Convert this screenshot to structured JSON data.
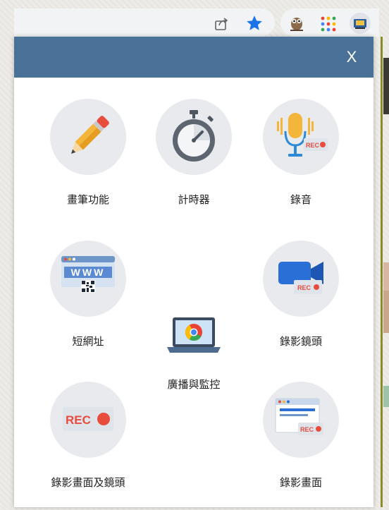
{
  "browser": {
    "toolbar_icons": [
      "share-icon",
      "star-icon",
      "owl-extension-icon",
      "apps-grid-icon",
      "extension-icon"
    ],
    "accent": "#1a73e8"
  },
  "popup": {
    "close_label": "X",
    "header_color": "#4a7198",
    "tools": [
      {
        "id": "pen",
        "label": "畫筆功能",
        "icon": "pencil-icon"
      },
      {
        "id": "timer",
        "label": "計時器",
        "icon": "stopwatch-icon"
      },
      {
        "id": "audio",
        "label": "錄音",
        "icon": "microphone-rec-icon"
      },
      {
        "id": "shorturl",
        "label": "短網址",
        "icon": "www-qrcode-icon"
      },
      {
        "id": "broadcast",
        "label": "廣播與監控",
        "icon": "chrome-laptop-icon"
      },
      {
        "id": "camera",
        "label": "錄影鏡頭",
        "icon": "camera-rec-icon"
      },
      {
        "id": "screencam",
        "label": "錄影畫面及鏡頭",
        "icon": "rec-button-icon"
      },
      {
        "id": "screen",
        "label": "錄影畫面",
        "icon": "browser-window-rec-icon"
      }
    ],
    "rec_text": "REC",
    "www_text": "WWW"
  }
}
